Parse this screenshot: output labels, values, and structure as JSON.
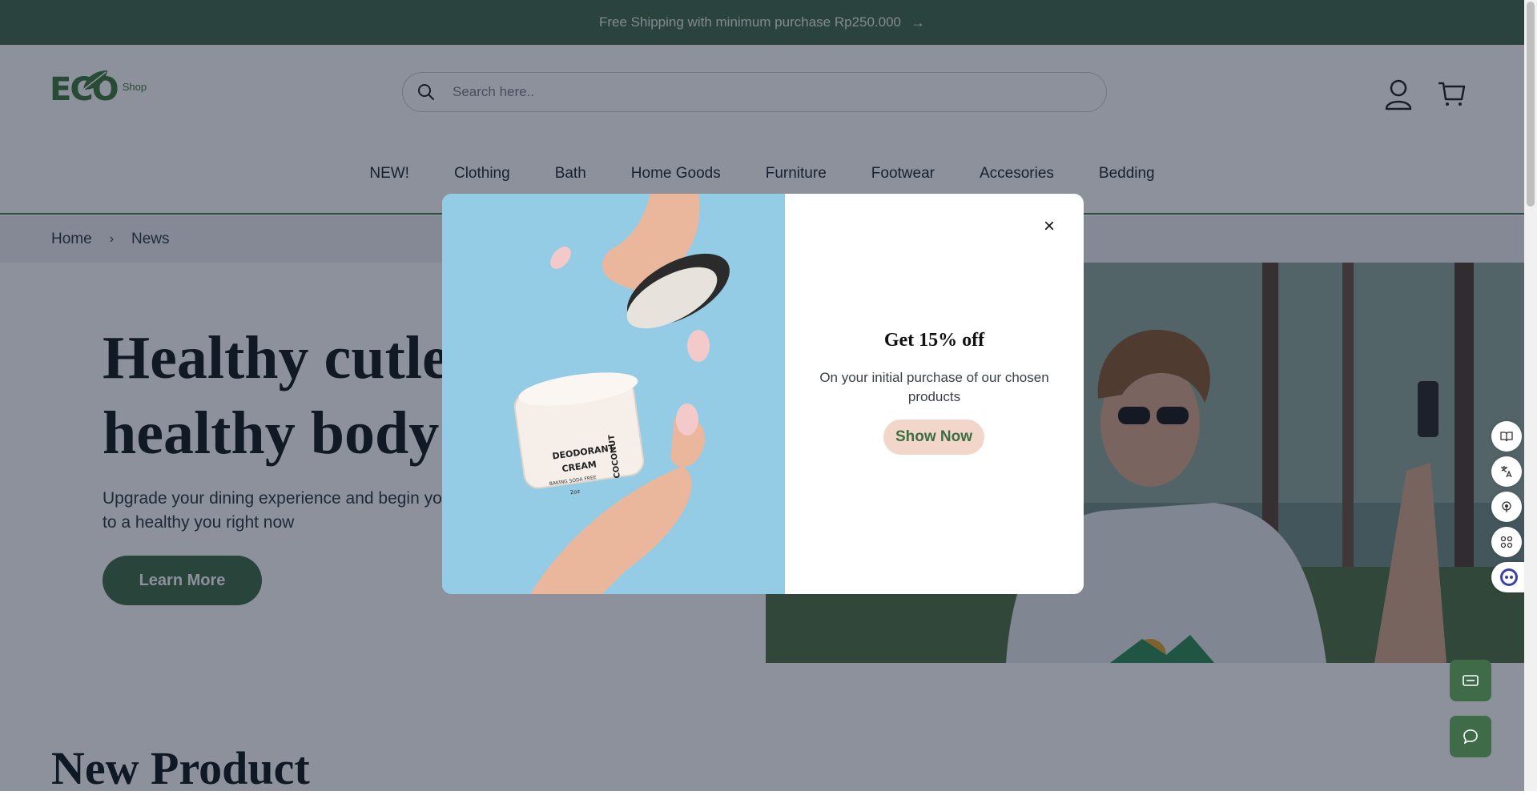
{
  "announcement": {
    "text": "Free Shipping with minimum purchase Rp250.000",
    "arrow": "→"
  },
  "logo": {
    "main": "ECO",
    "sub": "Shop"
  },
  "search": {
    "placeholder": "Search here.."
  },
  "nav": [
    "NEW!",
    "Clothing",
    "Bath",
    "Home Goods",
    "Furniture",
    "Footwear",
    "Accesories",
    "Bedding"
  ],
  "breadcrumb": {
    "home": "Home",
    "separator": "›",
    "current": "News"
  },
  "hero": {
    "title_line1": "Healthy cutlery,",
    "title_line2": "healthy body",
    "subtitle": "Upgrade your dining experience and begin your journey to a healthy you right now",
    "button": "Learn More"
  },
  "section": {
    "title": "New Product"
  },
  "modal": {
    "close": "×",
    "title": "Get 15% off",
    "body": "On your initial purchase of our chosen products",
    "button": "Show Now",
    "product_label": {
      "brand": "DEODORANT",
      "name": "CREAM",
      "note": "BAKING SODA FREE",
      "size": "2oz",
      "flavor": "COCONUT"
    }
  },
  "colors": {
    "brand_green": "#436a4d",
    "button_green": "#3f6b48",
    "peach": "#f2d6c9",
    "overlay": "rgba(16,26,46,0.48)"
  },
  "icons": [
    "arrow-right-icon",
    "search-icon",
    "user-icon",
    "cart-icon",
    "chevron-right-icon",
    "close-icon",
    "book-icon",
    "translate-icon",
    "podcast-icon",
    "apps-icon",
    "assistant-icon",
    "ticket-icon",
    "chat-icon"
  ]
}
